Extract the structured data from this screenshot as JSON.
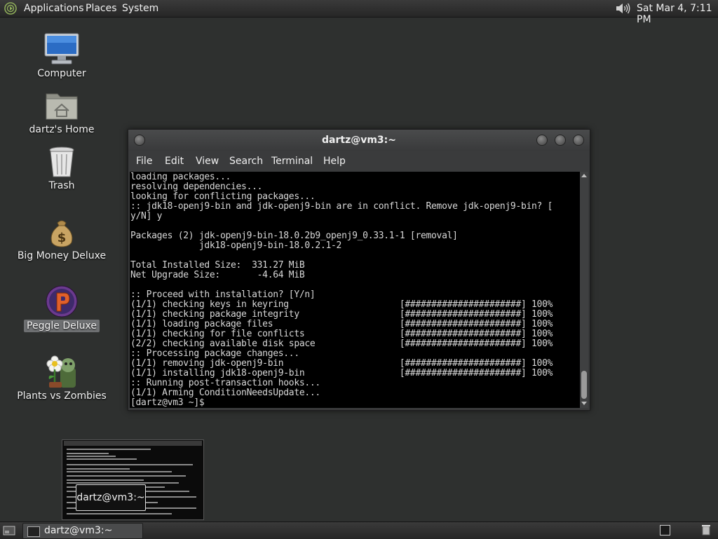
{
  "top_panel": {
    "menus": [
      "Applications",
      "Places",
      "System"
    ],
    "clock": "Sat Mar  4,  7:11 PM"
  },
  "desktop": {
    "icons": [
      {
        "label": "Computer",
        "icon": "computer-icon"
      },
      {
        "label": "dartz's Home",
        "icon": "home-folder-icon"
      },
      {
        "label": "Trash",
        "icon": "trash-icon"
      },
      {
        "label": "Big Money Deluxe",
        "icon": "money-bag-icon"
      },
      {
        "label": "Peggle Deluxe",
        "icon": "peggle-icon",
        "selected": true
      },
      {
        "label": "Plants vs Zombies",
        "icon": "plants-vs-zombies-icon"
      }
    ]
  },
  "terminal": {
    "title": "dartz@vm3:~",
    "menu": [
      "File",
      "Edit",
      "View",
      "Search",
      "Terminal",
      "Help"
    ],
    "lines": [
      "loading packages...",
      "resolving dependencies...",
      "looking for conflicting packages...",
      ":: jdk18-openj9-bin and jdk-openj9-bin are in conflict. Remove jdk-openj9-bin? [",
      "y/N] y",
      "",
      "Packages (2) jdk-openj9-bin-18.0.2b9_openj9_0.33.1-1 [removal]",
      "             jdk18-openj9-bin-18.0.2.1-2",
      "",
      "Total Installed Size:  331.27 MiB",
      "Net Upgrade Size:       -4.64 MiB",
      "",
      ":: Proceed with installation? [Y/n]",
      "(1/1) checking keys in keyring                     [######################] 100%",
      "(1/1) checking package integrity                   [######################] 100%",
      "(1/1) loading package files                        [######################] 100%",
      "(1/1) checking for file conflicts                  [######################] 100%",
      "(2/2) checking available disk space                [######################] 100%",
      ":: Processing package changes...",
      "(1/1) removing jdk-openj9-bin                      [######################] 100%",
      "(1/1) installing jdk18-openj9-bin                  [######################] 100%",
      ":: Running post-transaction hooks...",
      "(1/1) Arming ConditionNeedsUpdate...",
      "[dartz@vm3 ~]$ "
    ]
  },
  "preview": {
    "tooltip": "dartz@vm3:~"
  },
  "bottom_panel": {
    "task_label": "dartz@vm3:~"
  }
}
